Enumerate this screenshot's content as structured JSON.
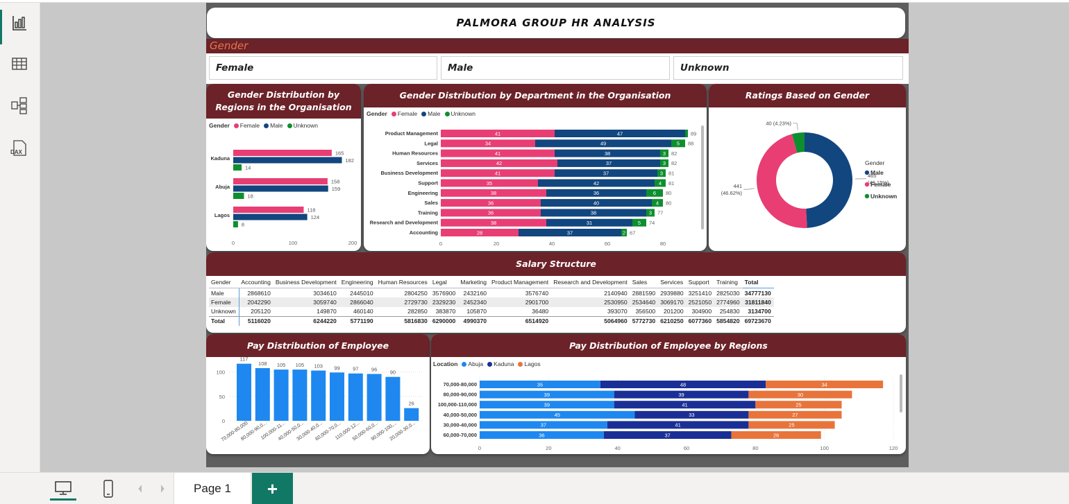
{
  "app": {
    "rail": [
      {
        "name": "report-view-icon"
      },
      {
        "name": "table-view-icon"
      },
      {
        "name": "model-view-icon"
      },
      {
        "name": "dax-query-icon",
        "label": "DAX"
      }
    ],
    "pages": [
      "Page 1"
    ],
    "add_page_label": "+"
  },
  "report": {
    "title": "PALMORA GROUP HR ANALYSIS",
    "gender_header": "Gender",
    "slicers": [
      "Female",
      "Male",
      "Unknown"
    ]
  },
  "colors": {
    "female": "#e83e74",
    "male": "#12467f",
    "unknown": "#0e8f2f",
    "abuja": "#1e88f0",
    "kaduna": "#1a2f96",
    "lagos": "#e8743b",
    "header": "#6b2228",
    "pay": "#1e88f0"
  },
  "chart_data": [
    {
      "id": "regions",
      "type": "bar",
      "orientation": "horizontal",
      "title": "Gender Distribution by Regions in the Organisation",
      "legend_title": "Gender",
      "categories": [
        "Kaduna",
        "Abuja",
        "Lagos"
      ],
      "series": [
        {
          "name": "Female",
          "values": [
            165,
            158,
            118
          ]
        },
        {
          "name": "Male",
          "values": [
            182,
            159,
            124
          ]
        },
        {
          "name": "Unknown",
          "values": [
            14,
            18,
            8
          ]
        }
      ],
      "xlim": [
        0,
        200
      ],
      "xticks": [
        "0",
        "100",
        "200"
      ]
    },
    {
      "id": "department",
      "type": "bar",
      "orientation": "horizontal",
      "stacked": true,
      "title": "Gender Distribution by Department in the Organisation",
      "legend_title": "Gender",
      "categories": [
        "Product Management",
        "Legal",
        "Human Resources",
        "Services",
        "Business Development",
        "Support",
        "Engineering",
        "Sales",
        "Training",
        "Research and Development",
        "Accounting"
      ],
      "series": [
        {
          "name": "Female",
          "values": [
            41,
            34,
            41,
            42,
            41,
            35,
            38,
            36,
            36,
            38,
            28
          ]
        },
        {
          "name": "Male",
          "values": [
            47,
            49,
            38,
            37,
            37,
            42,
            36,
            40,
            38,
            31,
            37
          ]
        },
        {
          "name": "Unknown",
          "values": [
            1,
            5,
            3,
            3,
            3,
            4,
            6,
            4,
            3,
            5,
            2
          ]
        }
      ],
      "totals": [
        89,
        88,
        82,
        82,
        81,
        81,
        80,
        80,
        77,
        74,
        67
      ],
      "xlim": [
        0,
        90
      ],
      "xticks": [
        "0",
        "20",
        "40",
        "60",
        "80"
      ]
    },
    {
      "id": "ratings",
      "type": "pie",
      "donut": true,
      "title": "Ratings Based on Gender",
      "legend_title": "Gender",
      "slices": [
        {
          "name": "Male",
          "value": 465,
          "label": "465\n(49.15%)"
        },
        {
          "name": "Female",
          "value": 441,
          "label": "441\n(46.62%)"
        },
        {
          "name": "Unknown",
          "value": 40,
          "label": "40 (4.23%)"
        }
      ]
    },
    {
      "id": "pay",
      "type": "bar",
      "title": "Pay Distribution of Employee",
      "categories": [
        "70,000-80,000",
        "80,000-90,0...",
        "100,000-11...",
        "40,000-50,0...",
        "30,000-40,0...",
        "60,000-70,0...",
        "110,000-12...",
        "50,000-60,0...",
        "90,000-100,...",
        "20,000-30,0..."
      ],
      "values": [
        117,
        108,
        105,
        105,
        103,
        99,
        97,
        96,
        90,
        26
      ],
      "ylim": [
        0,
        125
      ],
      "yticks": [
        "0",
        "50",
        "100"
      ]
    },
    {
      "id": "pay_regions",
      "type": "bar",
      "orientation": "horizontal",
      "stacked": true,
      "title": "Pay Distribution of Employee by Regions",
      "legend_title": "Location",
      "categories": [
        "70,000-80,000",
        "80,000-90,000",
        "100,000-110,000",
        "40,000-50,000",
        "30,000-40,000",
        "60,000-70,000"
      ],
      "series": [
        {
          "name": "Abuja",
          "values": [
            35,
            39,
            39,
            45,
            37,
            36
          ]
        },
        {
          "name": "Kaduna",
          "values": [
            48,
            39,
            41,
            33,
            41,
            37
          ]
        },
        {
          "name": "Lagos",
          "values": [
            34,
            30,
            25,
            27,
            25,
            26
          ]
        }
      ],
      "xlim": [
        0,
        120
      ],
      "xticks": [
        "0",
        "20",
        "40",
        "60",
        "80",
        "100",
        "120"
      ]
    }
  ],
  "salary": {
    "title": "Salary Structure",
    "columns": [
      "Gender",
      "Accounting",
      "Business Development",
      "Engineering",
      "Human Resources",
      "Legal",
      "Marketing",
      "Product Management",
      "Research and Development",
      "Sales",
      "Services",
      "Support",
      "Training",
      "Total"
    ],
    "rows": [
      [
        "Male",
        "2868610",
        "3034610",
        "2445010",
        "2804250",
        "3576900",
        "2432160",
        "3576740",
        "2140940",
        "2881590",
        "2939880",
        "3251410",
        "2825030",
        "34777130"
      ],
      [
        "Female",
        "2042290",
        "3059740",
        "2866040",
        "2729730",
        "2329230",
        "2452340",
        "2901700",
        "2530950",
        "2534640",
        "3069170",
        "2521050",
        "2774960",
        "31811840"
      ],
      [
        "Unknown",
        "205120",
        "149870",
        "460140",
        "282850",
        "383870",
        "105870",
        "36480",
        "393070",
        "356500",
        "201200",
        "304900",
        "254830",
        "3134700"
      ],
      [
        "Total",
        "5116020",
        "6244220",
        "5771190",
        "5816830",
        "6290000",
        "4990370",
        "6514920",
        "5064960",
        "5772730",
        "6210250",
        "6077360",
        "5854820",
        "69723670"
      ]
    ]
  }
}
